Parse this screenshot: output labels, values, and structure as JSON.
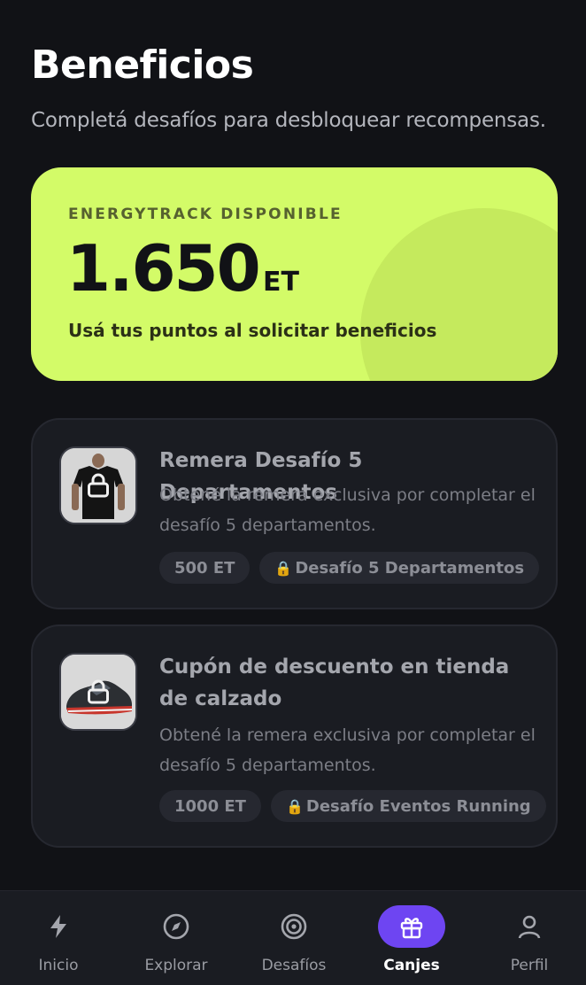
{
  "header": {
    "title": "Beneficios",
    "subtitle": "Completá desafíos para desbloquear recompensas."
  },
  "points": {
    "label": "ENERGYTRACK DISPONIBLE",
    "value": "1.650",
    "unit": "ET",
    "note": "Usá tus puntos al solicitar beneficios",
    "accent_color": "#d3fb68"
  },
  "benefits": [
    {
      "title": "Remera Desafío 5 Departamentos",
      "description": "Obtené la remera exclusiva por completar el desafío 5 departamentos.",
      "cost": "500 ET",
      "requirement": "Desafío 5 Departamentos",
      "image_icon": "tshirt-icon",
      "locked": true
    },
    {
      "title": "Cupón de descuento en tienda de calzado",
      "description": "Obtené la remera exclusiva por completar el desafío 5 departamentos.",
      "cost": "1000 ET",
      "requirement": "Desafío Eventos Running",
      "image_icon": "sneaker-icon",
      "locked": true
    }
  ],
  "tabbar": {
    "active_color": "#6e45f2",
    "tabs": [
      {
        "label": "Inicio",
        "icon": "lightning-icon",
        "active": false
      },
      {
        "label": "Explorar",
        "icon": "compass-icon",
        "active": false
      },
      {
        "label": "Desafíos",
        "icon": "target-icon",
        "active": false
      },
      {
        "label": "Canjes",
        "icon": "gift-icon",
        "active": true
      },
      {
        "label": "Perfil",
        "icon": "user-icon",
        "active": false
      }
    ]
  }
}
